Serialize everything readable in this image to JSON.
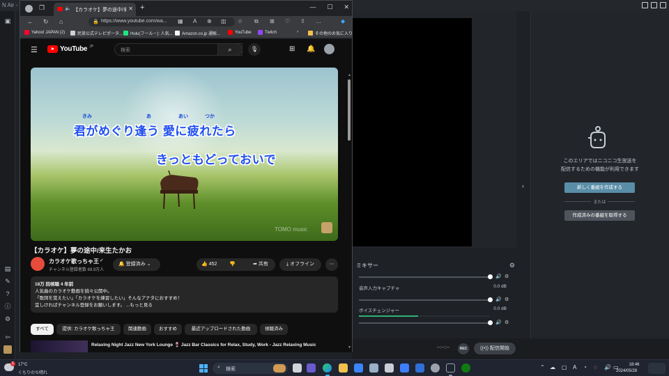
{
  "nair": {
    "title": "N Air - V",
    "mixer": {
      "title": "ミキサー",
      "channels": [
        {
          "name": "",
          "db": "",
          "level": 0.0
        },
        {
          "name": "音声入力キャプチャ",
          "db": "0.0 dB",
          "level": 0.0
        },
        {
          "name": "ボイスチェンジャー",
          "db": "0.0 dB",
          "level": 0.45
        }
      ]
    },
    "timecode": "--:--:--",
    "rec_label": "REC",
    "start_broadcast": "配信開始",
    "panel_line1": "このエリアではニコニコ生放送を",
    "panel_line2": "配信するための機能が利用できます",
    "create_program": "新しく番組を作成する",
    "or_label": "または",
    "fetch_program": "作成済みの番組を取得する"
  },
  "browser": {
    "tab_title": "【カラオケ】夢の途中/来生たかお",
    "url": "https://www.youtube.com/wa...",
    "bookmarks": [
      "Yahoo! JAPAN (2)",
      "民放公式テレビポータ...",
      "Hulu(フール－): 人気...",
      "Amazon.co.jp 通販...",
      "YouTube",
      "Twitch",
      "その他のお気に入り"
    ]
  },
  "youtube": {
    "logo": "YouTube",
    "logo_region": "JP",
    "search_placeholder": "検索",
    "video": {
      "ruby": [
        "きみ",
        "あ",
        "あい",
        "つか"
      ],
      "lyric1": "君がめぐり逢う 愛に疲れたら",
      "lyric2": "きっともどっておいで",
      "watermark": "TOMO music"
    },
    "title": "【カラオケ】夢の途中/来生たかお",
    "channel": "カラオケ歌っちゃ王",
    "subscribers": "チャンネル登録者数 69.9万人",
    "subscribed_label": "登録済み",
    "likes": "452",
    "share_label": "共有",
    "offline_label": "オフライン",
    "description": {
      "stats": "18万 回視聴  4 年前",
      "line1": "人気曲のカラオケ動画を続々公開中。",
      "line2": "「歌詞を覚えたい」「カラオケを練習したい」そんなアナタにおすすめ！",
      "line3": "宜しければチャンネル登録をお願いします。  ...もっと見る"
    },
    "chips": [
      "すべて",
      "提供: カラオケ歌っちゃ王",
      "関連動画",
      "おすすめ",
      "最近アップロードされた動画",
      "視聴済み"
    ],
    "next_video": "Relaxing Night Jazz New York Lounge 🍷 Jazz Bar Classics for Relax, Study, Work - Jazz Relaxing Music"
  },
  "taskbar": {
    "weather_temp": "17°C",
    "weather_desc": "くもりのち晴れ",
    "weather_badge": "1",
    "search_label": "検索",
    "time": "18:46",
    "date": "2024/05/28"
  },
  "colors": {
    "youtube_red": "#ff0000",
    "lyric_blue": "#1f4ff0",
    "nair_button": "#5a8ea8",
    "mixer_green": "#2db27c"
  }
}
